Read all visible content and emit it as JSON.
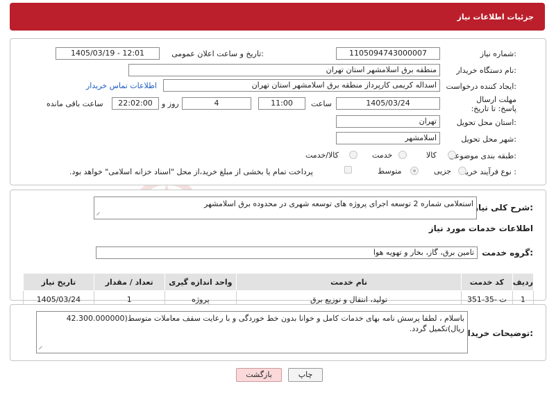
{
  "header": {
    "title": "جزئیات اطلاعات نیاز"
  },
  "form": {
    "need_number_label": "شماره نیاز:",
    "need_number": "1105094743000007",
    "announce_label": "تاریخ و ساعت اعلان عمومی:",
    "announce_value": "1405/03/19 - 12:01",
    "buyer_org_label": "نام دستگاه خریدار:",
    "buyer_org": "منطقه برق اسلامشهر استان تهران",
    "creator_label": "ایجاد کننده درخواست:",
    "creator": "اسداله کریمی کارپرداز منطقه برق اسلامشهر استان تهران",
    "contact_link": "اطلاعات تماس خریدار",
    "deadline_label": "مهلت ارسال پاسخ: تا تاریخ:",
    "deadline_date": "1405/03/24",
    "time_label": "ساعت",
    "deadline_time": "11:00",
    "days_value": "4",
    "days_label": "روز و",
    "remaining_time": "22:02:00",
    "remaining_label": "ساعت باقی مانده",
    "province_label": "استان محل تحویل:",
    "province": "تهران",
    "city_label": "شهر محل تحویل:",
    "city": "اسلامشهر",
    "category_label": "طبقه بندی موضوعی:",
    "category_options": [
      "کالا",
      "خدمت",
      "کالا/خدمت"
    ],
    "process_label": "نوع فرآیند خرید :",
    "process_options": [
      "جزیی",
      "متوسط"
    ],
    "payment_note": "پرداخت تمام یا بخشی از مبلغ خرید،از محل \"اسناد خزانه اسلامی\" خواهد بود."
  },
  "summary": {
    "label": "شرح کلی نیاز:",
    "text": "استعلامی شماره 2 توسعه اجرای پروژه های توسعه شهری در محدوده برق اسلامشهر"
  },
  "services": {
    "section_title": "اطلاعات خدمات مورد نیاز",
    "group_label": "گروه خدمت:",
    "group_value": "تامین برق، گاز، بخار و تهویه هوا",
    "columns": [
      "ردیف",
      "کد خدمت",
      "نام خدمت",
      "واحد اندازه گیری",
      "تعداد / مقدار",
      "تاریخ نیاز"
    ],
    "rows": [
      [
        "1",
        "ت -35-351",
        "تولید، انتقال و توزیع برق",
        "پروژه",
        "1",
        "1405/03/24"
      ]
    ]
  },
  "buyer_notes": {
    "label": "توضیحات خریدار:",
    "text": "باسلام ، لطفا پرسش نامه بهای خدمات کامل و خوانا بدون خط خوردگی و با رعایت سقف معاملات متوسط(42.300.000000 ریال)تکمیل گردد."
  },
  "buttons": {
    "print": "چاپ",
    "back": "بازگشت"
  },
  "colors": {
    "header_bg": "#bb1f2b",
    "link": "#1a5bc4",
    "table_header": "#e2e2e2"
  }
}
